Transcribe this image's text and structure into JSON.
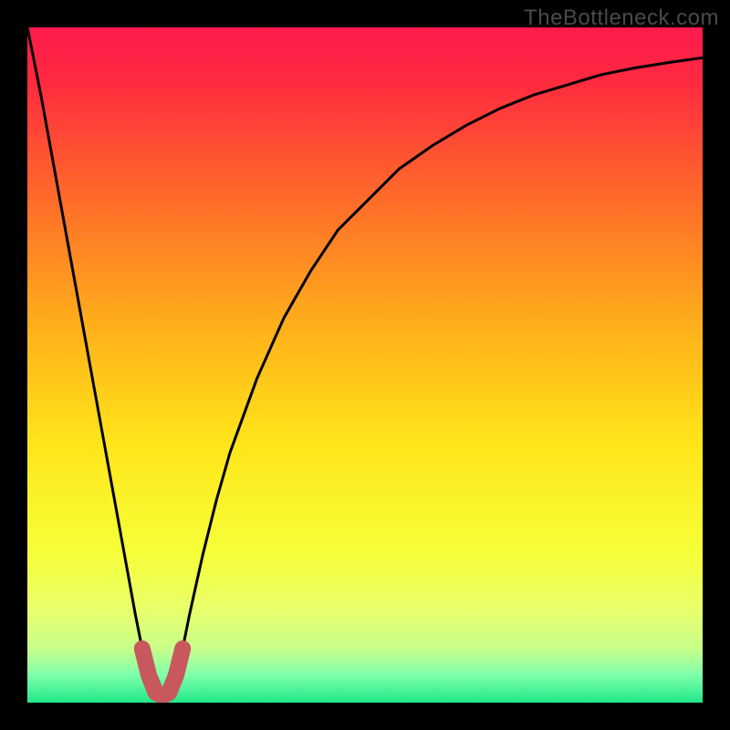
{
  "watermark": "TheBottleneck.com",
  "chart_data": {
    "type": "line",
    "title": "",
    "xlabel": "",
    "ylabel": "",
    "xlim": [
      0,
      100
    ],
    "ylim": [
      0,
      100
    ],
    "series": [
      {
        "name": "bottleneck-curve",
        "x": [
          0,
          2,
          4,
          6,
          8,
          10,
          12,
          14,
          16,
          17,
          18,
          19,
          20,
          21,
          22,
          23,
          24,
          26,
          28,
          30,
          34,
          38,
          42,
          46,
          50,
          55,
          60,
          65,
          70,
          75,
          80,
          85,
          90,
          95,
          100
        ],
        "y": [
          100,
          90,
          79,
          68,
          57,
          46,
          35,
          24,
          13,
          8,
          4,
          1.5,
          1,
          1.5,
          4,
          8,
          13,
          22,
          30,
          37,
          48,
          57,
          64,
          70,
          74,
          79,
          82.5,
          85.5,
          88,
          90,
          91.5,
          93,
          94,
          94.8,
          95.5
        ]
      },
      {
        "name": "highlight-segment",
        "x": [
          17,
          18,
          19,
          20,
          21,
          22,
          23
        ],
        "y": [
          8,
          4,
          1.5,
          1,
          1.5,
          4,
          8
        ]
      }
    ],
    "gradient_stops": [
      {
        "offset": 0,
        "color": "#ff1a4d"
      },
      {
        "offset": 0.08,
        "color": "#ff2a3f"
      },
      {
        "offset": 0.25,
        "color": "#ff6a2a"
      },
      {
        "offset": 0.45,
        "color": "#ffb21a"
      },
      {
        "offset": 0.62,
        "color": "#ffe61a"
      },
      {
        "offset": 0.78,
        "color": "#f6ff3a"
      },
      {
        "offset": 0.86,
        "color": "#eaff6a"
      },
      {
        "offset": 0.92,
        "color": "#c8ff8a"
      },
      {
        "offset": 0.96,
        "color": "#7dffab"
      },
      {
        "offset": 1.0,
        "color": "#20e889"
      }
    ],
    "colors": {
      "curve": "#000000",
      "highlight": "#c9575e",
      "background_frame": "#000000"
    }
  }
}
